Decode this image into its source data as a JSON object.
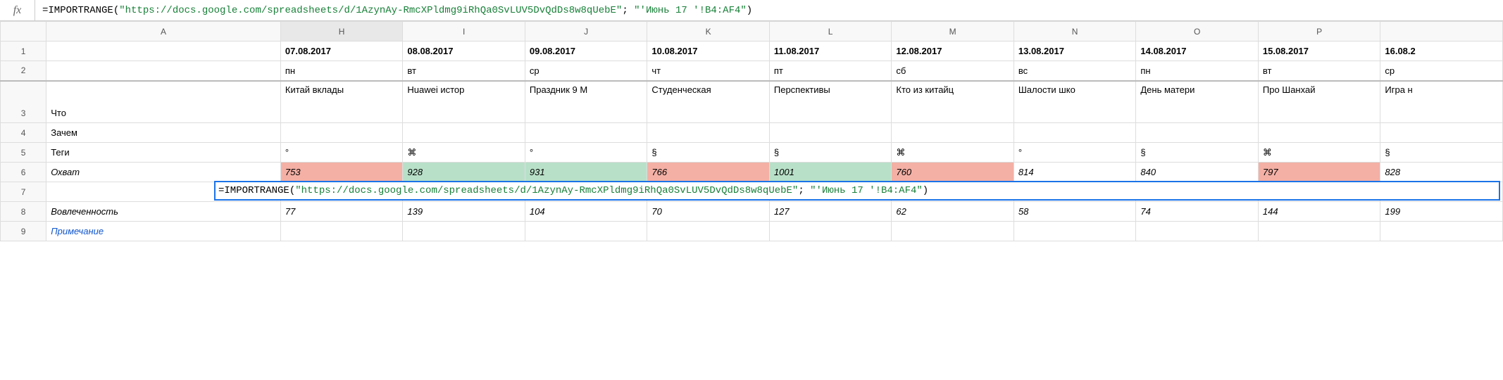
{
  "formula_bar": {
    "fx_label": "fx",
    "prefix": "=IMPORTRANGE(",
    "arg1": "\"https://docs.google.com/spreadsheets/d/1AzynAy-RmcXPldmg9iRhQa0SvLUV5DvQdDs8w8qUebE\"",
    "sep": "; ",
    "arg2": "\"'Июнь 17 '!B4:AF4\"",
    "suffix": ")"
  },
  "columns": [
    "A",
    "H",
    "I",
    "J",
    "K",
    "L",
    "M",
    "N",
    "O",
    "P",
    ""
  ],
  "rows": {
    "1": {
      "A": "",
      "data": [
        "07.08.2017",
        "08.08.2017",
        "09.08.2017",
        "10.08.2017",
        "11.08.2017",
        "12.08.2017",
        "13.08.2017",
        "14.08.2017",
        "15.08.2017",
        "16.08.2"
      ]
    },
    "2": {
      "A": "",
      "data": [
        "пн",
        "вт",
        "ср",
        "чт",
        "пт",
        "сб",
        "вс",
        "пн",
        "вт",
        "ср"
      ]
    },
    "3": {
      "A": "Что",
      "data": [
        "Китай вклады",
        "Huawei истор",
        "Праздник 9 М",
        "Студенческая",
        "Перспективы",
        "Кто из китайц",
        "Шалости шко",
        "День матери",
        "Про Шанхай",
        "Игра н"
      ]
    },
    "4": {
      "A": "Зачем",
      "data": [
        "",
        "",
        "",
        "",
        "",
        "",
        "",
        "",
        "",
        ""
      ]
    },
    "5": {
      "A": "Теги",
      "data": [
        "°",
        "⌘",
        "°",
        "§",
        "§",
        "⌘",
        "°",
        "§",
        "⌘",
        "§"
      ]
    },
    "6": {
      "A": "Охват",
      "data": [
        "753",
        "928",
        "931",
        "766",
        "1001",
        "760",
        "814",
        "840",
        "797",
        "828"
      ],
      "bg": [
        "red",
        "green",
        "green",
        "red",
        "green",
        "red",
        "",
        "",
        "red",
        ""
      ]
    },
    "7": {
      "A": "",
      "data": [
        "",
        "",
        "",
        "",
        "",
        "",
        "",
        "",
        "",
        ""
      ]
    },
    "8": {
      "A": "Вовлеченность",
      "data": [
        "77",
        "139",
        "104",
        "70",
        "127",
        "62",
        "58",
        "74",
        "144",
        "199"
      ]
    },
    "9": {
      "A": "Примечание",
      "data": [
        "",
        "",
        "",
        "",
        "",
        "",
        "",
        "",
        "",
        ""
      ]
    }
  },
  "inline_formula": {
    "prefix": "=IMPORTRANGE(",
    "arg1": "\"https://docs.google.com/spreadsheets/d/1AzynAy-RmcXPldmg9iRhQa0SvLUV5DvQdDs8w8qUebE\"",
    "sep": "; ",
    "arg2": "\"'Июнь 17 '!B4:AF4\"",
    "suffix": ")"
  }
}
